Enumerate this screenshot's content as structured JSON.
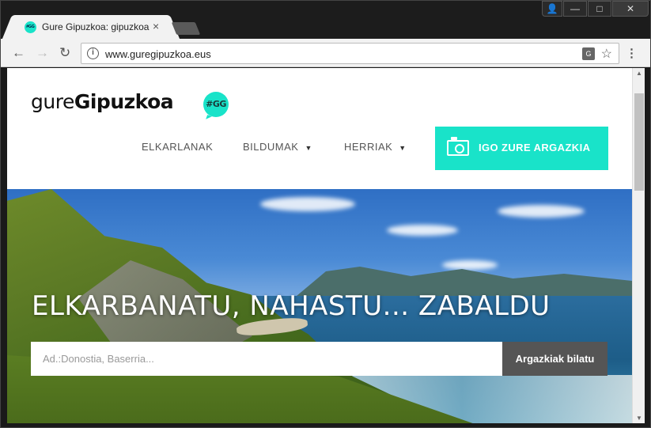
{
  "browser": {
    "tab_title": "Gure Gipuzkoa: gipuzkoa",
    "favicon_text": "#GG",
    "url": "www.guregipuzkoa.eus",
    "window_controls": {
      "user": "👤",
      "minimize": "—",
      "maximize": "□",
      "close": "✕"
    }
  },
  "site": {
    "logo": {
      "light": "gure",
      "bold": "Gipuzkoa",
      "badge": "#GG"
    },
    "nav": [
      {
        "label": "ELKARLANAK",
        "has_dropdown": false
      },
      {
        "label": "BILDUMAK",
        "has_dropdown": true
      },
      {
        "label": "HERRIAK",
        "has_dropdown": true
      }
    ],
    "upload_button": "IGO ZURE ARGAZKIA",
    "accent_color": "#19e3c9"
  },
  "hero": {
    "title": "ELKARBANATU, NAHASTU... ZABALDU",
    "search_placeholder": "Ad.:Donostia, Baserria...",
    "search_button": "Argazkiak bilatu"
  }
}
